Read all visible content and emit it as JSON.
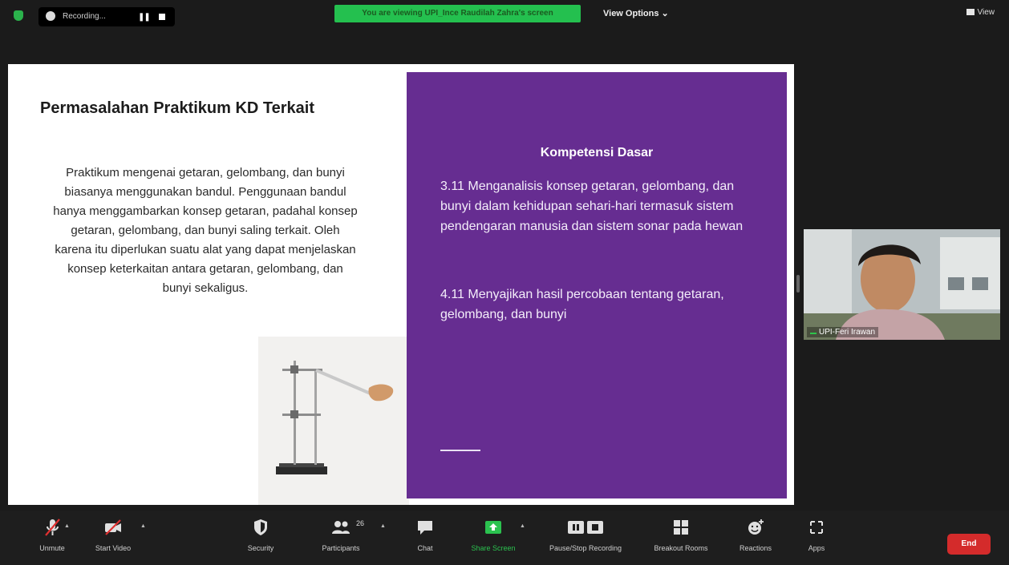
{
  "top_bar": {
    "recording_label": "Recording...",
    "viewing_banner": "You are viewing UPI_Ince Raudilah Zahra's screen",
    "view_options_label": "View Options",
    "view_label": "View"
  },
  "slide": {
    "title": "Permasalahan Praktikum KD Terkait",
    "paragraph": "Praktikum mengenai getaran, gelombang, dan bunyi biasanya menggunakan bandul. Penggunaan bandul hanya menggambarkan konsep getaran, padahal konsep getaran, gelombang, dan bunyi saling terkait. Oleh karena itu diperlukan suatu alat yang dapat menjelaskan konsep keterkaitan antara getaran, gelombang, dan bunyi sekaligus.",
    "panel_title": "Kompetensi Dasar",
    "kd_items": [
      "3.11 Menganalisis konsep getaran, gelombang, dan bunyi dalam kehidupan sehari-hari termasuk sistem pendengaran manusia dan sistem sonar pada hewan",
      "4.11 Menyajikan hasil percobaan tentang getaran, gelombang, dan bunyi"
    ],
    "panel_color": "#662d91"
  },
  "participant": {
    "name": "UPI-Feri Irawan"
  },
  "toolbar": {
    "unmute": "Unmute",
    "start_video": "Start Video",
    "security": "Security",
    "participants": "Participants",
    "participants_count": "26",
    "chat": "Chat",
    "share_screen": "Share Screen",
    "pause_stop_recording": "Pause/Stop Recording",
    "breakout_rooms": "Breakout Rooms",
    "reactions": "Reactions",
    "apps": "Apps",
    "end": "End"
  },
  "colors": {
    "accent_green": "#24c04f",
    "end_red": "#d42b2b",
    "share_green": "#2bc24f"
  }
}
